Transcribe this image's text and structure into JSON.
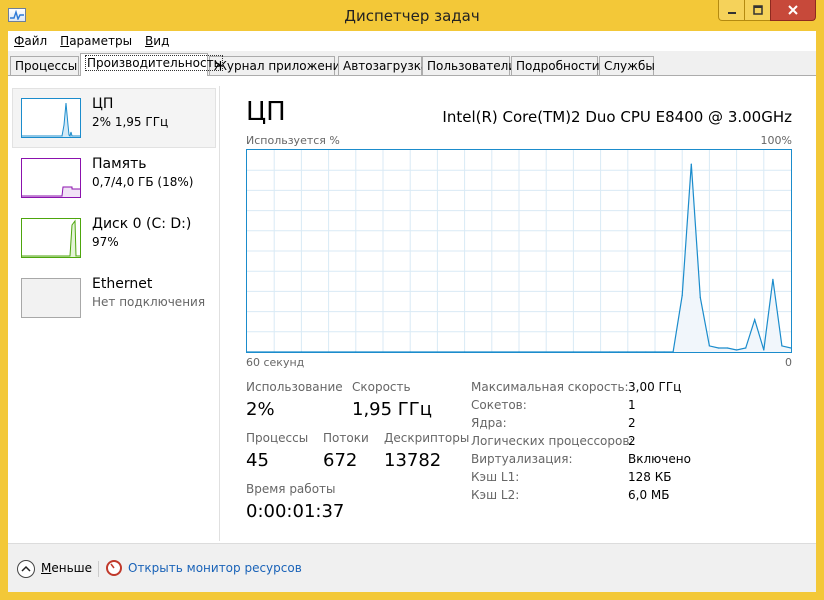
{
  "window": {
    "title": "Диспетчер задач"
  },
  "menu": [
    "Файл",
    "Параметры",
    "Вид"
  ],
  "tabs": [
    "Процессы",
    "Производительность",
    "Журнал приложений",
    "Автозагрузка",
    "Пользователи",
    "Подробности",
    "Службы"
  ],
  "active_tab": "Производительность",
  "sidebar": [
    {
      "title": "ЦП",
      "subtitle": "2% 1,95 ГГц",
      "color": "#1b8ccc",
      "selected": true
    },
    {
      "title": "Память",
      "subtitle": "0,7/4,0 ГБ (18%)",
      "color": "#8b12ae"
    },
    {
      "title": "Диск 0 (C: D:)",
      "subtitle": "97%",
      "color": "#4da60c"
    },
    {
      "title": "Ethernet",
      "subtitle": "Нет подключения",
      "color": "#a0a0a0"
    }
  ],
  "main": {
    "title": "ЦП",
    "cpu_name": "Intel(R) Core(TM)2 Duo CPU E8400 @ 3.00GHz",
    "graph": {
      "top_left": "Используется %",
      "top_right": "100%",
      "bottom_left": "60 секунд",
      "bottom_right": "0"
    }
  },
  "chart_data": {
    "type": "area",
    "title": "",
    "xlabel": "60 секунд",
    "ylabel": "Используется %",
    "xlim": [
      60,
      0
    ],
    "ylim": [
      0,
      100
    ],
    "grid": true,
    "x": [
      60,
      54,
      48,
      42,
      36,
      30,
      24,
      22,
      20,
      19,
      18,
      17,
      16,
      15,
      14,
      13,
      12,
      11,
      10,
      9,
      8,
      7,
      6,
      5,
      4,
      3,
      2,
      1,
      0
    ],
    "values": [
      0,
      0,
      0,
      0,
      0,
      0,
      0,
      0,
      0,
      0,
      0,
      0,
      0,
      0,
      0,
      0,
      28,
      93,
      27,
      3,
      2,
      2,
      1,
      2,
      16,
      1,
      36,
      3,
      2
    ]
  },
  "stats": {
    "usage_label": "Использование",
    "usage_value": "2%",
    "speed_label": "Скорость",
    "speed_value": "1,95 ГГц",
    "processes_label": "Процессы",
    "processes_value": "45",
    "threads_label": "Потоки",
    "threads_value": "672",
    "handles_label": "Дескрипторы",
    "handles_value": "13782",
    "uptime_label": "Время работы",
    "uptime_value": "0:00:01:37"
  },
  "info": [
    {
      "label": "Максимальная скорость:",
      "value": "3,00 ГГц"
    },
    {
      "label": "Сокетов:",
      "value": "1"
    },
    {
      "label": "Ядра:",
      "value": "2"
    },
    {
      "label": "Логических процессоров:",
      "value": "2"
    },
    {
      "label": "Виртуализация:",
      "value": "Включено"
    },
    {
      "label": "Кэш L1:",
      "value": "128 КБ"
    },
    {
      "label": "Кэш L2:",
      "value": "6,0 МБ"
    }
  ],
  "footer": {
    "less_label": "Меньше",
    "monitor_link": "Открыть монитор ресурсов"
  },
  "icons": {
    "app": "task-manager-icon",
    "less": "chevron-up-icon",
    "monitor": "resource-monitor-icon"
  }
}
